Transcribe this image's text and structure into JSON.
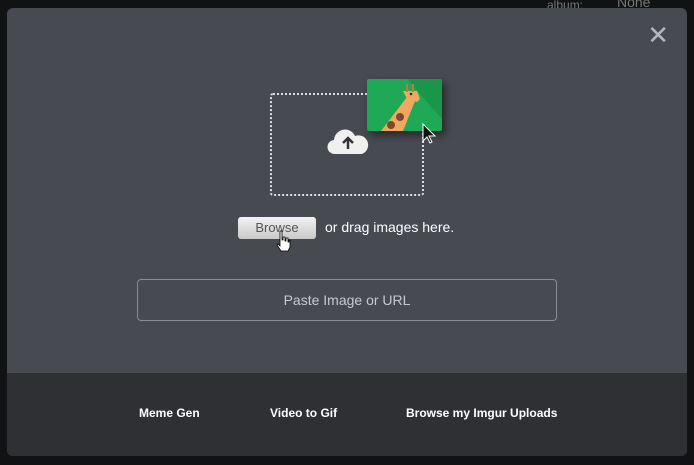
{
  "background": {
    "album_label": "album:",
    "album_value": "None"
  },
  "modal": {
    "close_icon": "close-icon",
    "browse_label": "Browse",
    "drag_text": "or drag images here.",
    "url_placeholder": "Paste Image or URL",
    "footer_links": [
      "Meme Gen",
      "Video to Gif",
      "Browse my Imgur Uploads"
    ]
  },
  "colors": {
    "modal_bg": "#474a51",
    "footer_bg": "#2e3034",
    "accent_green": "#1fa855"
  }
}
